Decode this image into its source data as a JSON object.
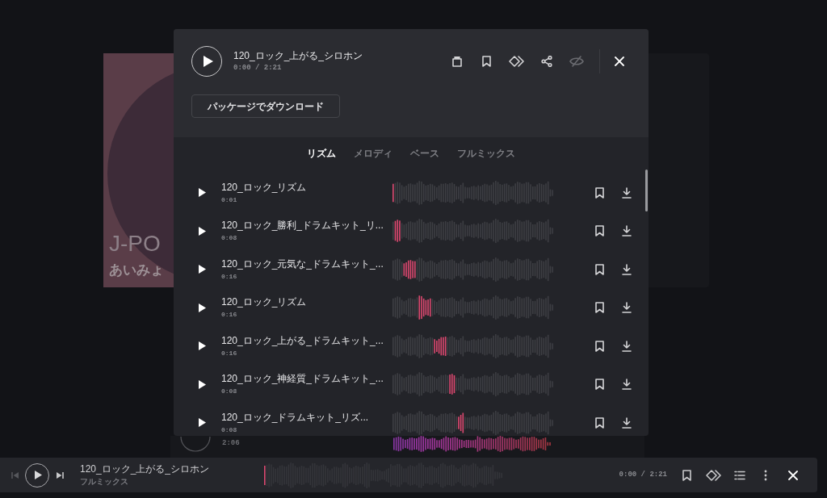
{
  "background": {
    "art_title": "J-PO",
    "art_artist": "あいみょ",
    "row_time": "2:06"
  },
  "modal": {
    "title": "120_ロック_上がる_シロホン",
    "time": "0:00 / 2:21",
    "download_button": "パッケージでダウンロード",
    "tabs": [
      {
        "label": "リズム",
        "selected": true
      },
      {
        "label": "メロディ",
        "selected": false
      },
      {
        "label": "ベース",
        "selected": false
      },
      {
        "label": "フルミックス",
        "selected": false
      }
    ],
    "rows": [
      {
        "title": "120_ロック_リズム",
        "time": "0:01"
      },
      {
        "title": "120_ロック_勝利_ドラムキット_リ...",
        "time": "0:08"
      },
      {
        "title": "120_ロック_元気な_ドラムキット_...",
        "time": "0:16"
      },
      {
        "title": "120_ロック_リズム",
        "time": "0:16"
      },
      {
        "title": "120_ロック_上がる_ドラムキット_...",
        "time": "0:16"
      },
      {
        "title": "120_ロック_神経質_ドラムキット_...",
        "time": "0:08"
      },
      {
        "title": "120_ロック_ドラムキット_リズ...",
        "time": "0:08"
      }
    ]
  },
  "player": {
    "title": "120_ロック_上がる_シロホン",
    "subtitle": "フルミックス",
    "time": "0:00 / 2:21"
  }
}
